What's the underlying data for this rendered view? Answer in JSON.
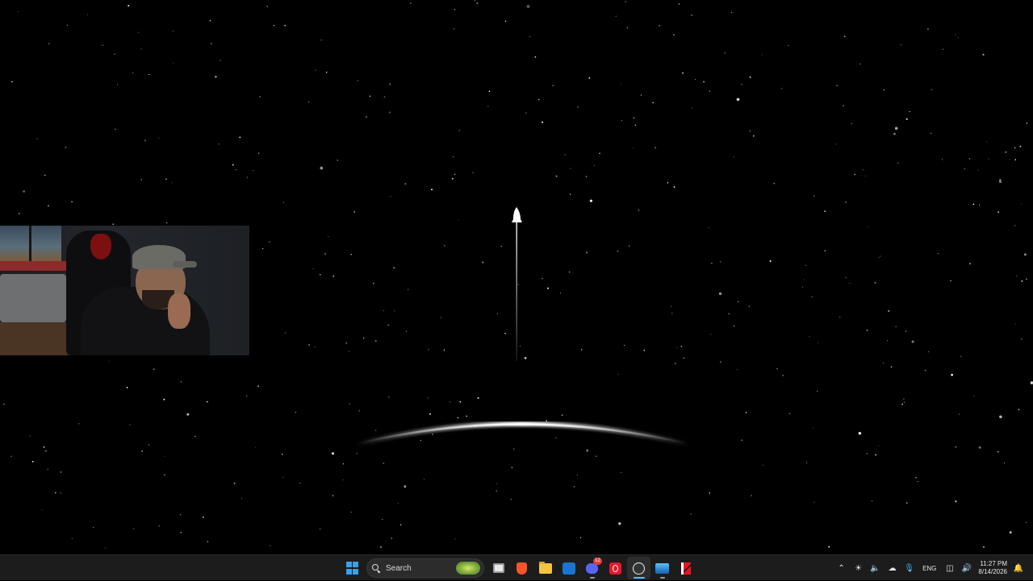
{
  "desktop": {
    "wallpaper": "space-rocket-launch",
    "colors": {
      "background": "#000000",
      "star": "#ffffff",
      "horizon": "#ffffff"
    }
  },
  "taskbar": {
    "search": {
      "label": "Search"
    },
    "apps": [
      {
        "name": "task-view",
        "icon": "task-view-icon"
      },
      {
        "name": "brave",
        "icon": "brave-icon"
      },
      {
        "name": "file-explorer",
        "icon": "folder-icon"
      },
      {
        "name": "outlook",
        "icon": "outlook-icon"
      },
      {
        "name": "discord",
        "icon": "discord-icon",
        "badge": "12"
      },
      {
        "name": "opera",
        "icon": "opera-icon"
      },
      {
        "name": "obs",
        "icon": "obs-icon"
      },
      {
        "name": "photos",
        "icon": "photos-icon"
      },
      {
        "name": "capcut",
        "icon": "capcut-icon"
      }
    ],
    "tray": {
      "language": "ENG",
      "time": "11:27 PM",
      "date": "8/14/2026"
    },
    "colors": {
      "background": "#1c1c1c",
      "accent": "#4cc2ff",
      "start": "#3aa0f0"
    }
  }
}
